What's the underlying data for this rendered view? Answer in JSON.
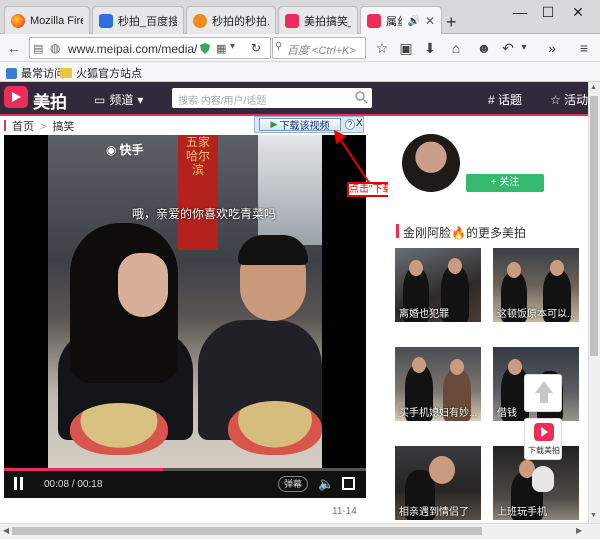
{
  "browser": {
    "tabs": [
      {
        "label": "Mozilla Fire...",
        "favicon": "firefox-icon"
      },
      {
        "label": "秒拍_百度搜索",
        "favicon": "baidu-icon"
      },
      {
        "label": "秒拍的秒拍...",
        "favicon": "orange-circle-icon"
      },
      {
        "label": "美拍搞笑_搞...",
        "favicon": "meipai-icon"
      },
      {
        "label": "属丝...",
        "favicon": "meipai-icon"
      }
    ],
    "new_tab": "+",
    "window_controls": {
      "minimize": "—",
      "maximize": "☐",
      "close": "✕"
    },
    "url": "www.meipai.com/media/",
    "search_placeholder": "百度 <Ctrl+K>",
    "bookmarks": [
      {
        "label": "最常访问"
      },
      {
        "label": "火狐官方站点"
      }
    ]
  },
  "site": {
    "brand": "美拍",
    "channel": "频道",
    "search_placeholder": "搜索 内容/用户/话题",
    "topics": "# 话题",
    "activity": "活动",
    "breadcrumb": {
      "home": "首页",
      "current": "搞笑"
    }
  },
  "download_toolbar": {
    "button_label": "下载该视频",
    "help": "?",
    "close": "X"
  },
  "annotation": {
    "label": "点击\"下载该视频\""
  },
  "video": {
    "watermark": "快手",
    "caption": "哦，亲爱的你喜欢吃青菜吗",
    "sign_text": "五家哈尔滨",
    "current_time": "00:08",
    "duration": "00:18",
    "progress_fraction": 0.44,
    "danmu_label": "弹幕",
    "date": "11-14"
  },
  "sidebar": {
    "follow_label": "+ 关注",
    "more_title": "金刚阿脸🔥的更多美拍",
    "thumbs": [
      {
        "caption": "离婚也犯罪"
      },
      {
        "caption": "这顿饭原本可以..."
      },
      {
        "caption": "买手机媳妇有妙..."
      },
      {
        "caption": "借钱"
      },
      {
        "caption": "相亲遇到情侣了"
      },
      {
        "caption": "上班玩手机"
      }
    ]
  },
  "floating": {
    "download_app": "下载美拍"
  },
  "colors": {
    "brand": "#ec2d5b",
    "header_bg": "#322a3a",
    "follow_green": "#35b96e",
    "annotation_red": "#e00000"
  }
}
